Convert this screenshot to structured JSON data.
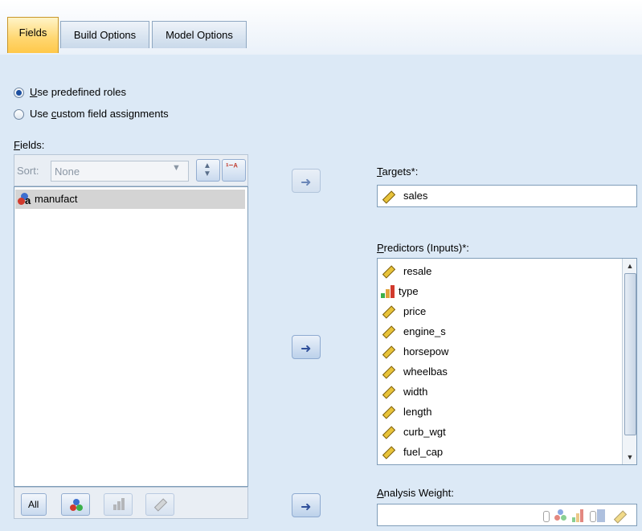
{
  "tabs": [
    {
      "label": "Fields"
    },
    {
      "label": "Build Options"
    },
    {
      "label": "Model Options"
    }
  ],
  "roles": {
    "predefined": {
      "pre": "",
      "u": "U",
      "post": "se predefined roles"
    },
    "custom": {
      "pre": "Use ",
      "u": "c",
      "post": "ustom field assignments"
    }
  },
  "fields_label": {
    "u": "F",
    "post": "ields:"
  },
  "sort": {
    "label": "Sort:",
    "value": "None"
  },
  "field_list": [
    {
      "name": "manufact",
      "icon": "nominal-string-icon"
    }
  ],
  "bottom_buttons": {
    "all_label": "All"
  },
  "targets": {
    "u": "T",
    "post": "argets*:",
    "value": "sales"
  },
  "predictors": {
    "u": "P",
    "post": "redictors (Inputs)*:",
    "items": [
      {
        "name": "resale",
        "icon": "continuous-ruler-icon"
      },
      {
        "name": "type",
        "icon": "ordinal-bar-icon"
      },
      {
        "name": "price",
        "icon": "continuous-ruler-icon"
      },
      {
        "name": "engine_s",
        "icon": "continuous-ruler-icon"
      },
      {
        "name": "horsepow",
        "icon": "continuous-ruler-icon"
      },
      {
        "name": "wheelbas",
        "icon": "continuous-ruler-icon"
      },
      {
        "name": "width",
        "icon": "continuous-ruler-icon"
      },
      {
        "name": "length",
        "icon": "continuous-ruler-icon"
      },
      {
        "name": "curb_wgt",
        "icon": "continuous-ruler-icon"
      },
      {
        "name": "fuel_cap",
        "icon": "continuous-ruler-icon"
      }
    ]
  },
  "analysis_weight": {
    "u": "A",
    "post": "nalysis Weight:",
    "value": ""
  }
}
